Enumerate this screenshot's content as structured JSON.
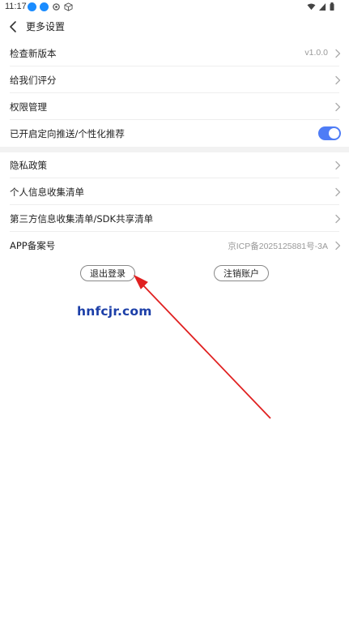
{
  "status_bar": {
    "time": "11:17",
    "left_icons": [
      "notification-icon",
      "notification-icon",
      "settings-icon",
      "box-icon"
    ],
    "right_icons": [
      "wifi-icon",
      "signal-icon",
      "battery-icon"
    ]
  },
  "header": {
    "title": "更多设置",
    "back_icon": "chevron-left-icon"
  },
  "settings": {
    "check_version": {
      "label": "检查新版本",
      "value": "v1.0.0"
    },
    "rate_us": {
      "label": "给我们评分"
    },
    "permissions": {
      "label": "权限管理"
    },
    "personalized_push": {
      "label": "已开启定向推送/个性化推荐",
      "enabled": true
    },
    "privacy_policy": {
      "label": "隐私政策"
    },
    "personal_info_list": {
      "label": "个人信息收集清单"
    },
    "third_party_list": {
      "label": "第三方信息收集清单/SDK共享清单"
    },
    "app_record": {
      "label": "APP备案号",
      "value": "京ICP备2025125881号-3A"
    }
  },
  "actions": {
    "logout_label": "退出登录",
    "delete_account_label": "注销账户"
  },
  "watermark": {
    "text": "hnfcjr.com"
  },
  "colors": {
    "accent": "#4e7cf6",
    "status_blue": "#1a8cff",
    "arrow_red": "#e02020",
    "watermark_blue": "#1c3fa8"
  }
}
